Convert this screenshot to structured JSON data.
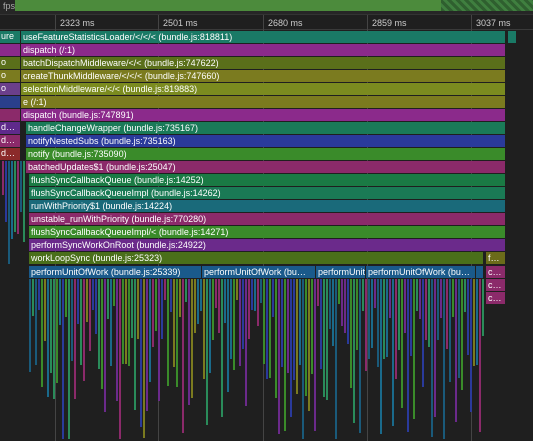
{
  "fps_label": "fps",
  "ruler": {
    "ticks": [
      "2323 ms",
      "2501 ms",
      "2680 ms",
      "2859 ms",
      "3037 ms"
    ]
  },
  "flame": {
    "rows": [
      {
        "label": "useFeatureStatisticsLoader/</</< (bundle.js:818811)"
      },
      {
        "label": "dispatch (/:1)"
      },
      {
        "label": "batchDispatchMiddleware/</< (bundle.js:747622)"
      },
      {
        "label": "createThunkMiddleware/</</< (bundle.js:747660)"
      },
      {
        "label": "selectionMiddleware/</< (bundle.js:819883)"
      },
      {
        "label": "e (/:1)"
      },
      {
        "label": "dispatch (bundle.js:747891)"
      },
      {
        "label": "handleChangeWrapper (bundle.js:735167)"
      },
      {
        "label": "notifyNestedSubs (bundle.js:735163)"
      },
      {
        "label": "notify (bundle.js:735090)"
      },
      {
        "label": "batchedUpdates$1 (bundle.js:25047)"
      },
      {
        "label": "flushSyncCallbackQueue (bundle.js:14252)"
      },
      {
        "label": "flushSyncCallbackQueueImpl (bundle.js:14262)"
      },
      {
        "label": "runWithPriority$1 (bundle.js:14224)"
      },
      {
        "label": "unstable_runWithPriority (bundle.js:770280)"
      },
      {
        "label": "flushSyncCallbackQueueImpl/< (bundle.js:14271)"
      },
      {
        "label": "performSyncWorkOnRoot (bundle.js:24922)"
      },
      {
        "label": "workLoopSync (bundle.js:25323)"
      }
    ],
    "work_units": [
      "performUnitOfWork (bundle.js:25339)",
      "performUnitOfWork (bu…",
      "performUnitOfWork (bu…",
      "performUnitOfWork (bu…",
      "performUnitOfWork (bu…"
    ],
    "truncated": [
      "f…",
      "c…",
      "c…",
      "c…"
    ],
    "left_stubs": [
      "ure",
      "o",
      "o",
      "o",
      "",
      "",
      "",
      "d…",
      "d…",
      "d…"
    ]
  }
}
